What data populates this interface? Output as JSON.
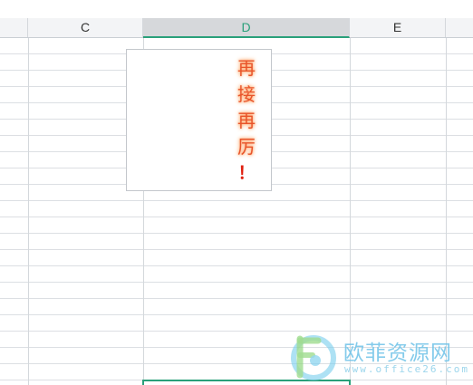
{
  "column_headers": {
    "left": "",
    "c": "C",
    "d": "D",
    "e": "E",
    "f": ""
  },
  "selected_column": "D",
  "text_box": {
    "chars": [
      "再",
      "接",
      "再",
      "厉",
      "！"
    ],
    "color": "#e8542a",
    "glow_color": "#ffb07a"
  },
  "watermark": {
    "title": "欧菲资源网",
    "url": "www.office26.com",
    "color": "#6fc3e8"
  },
  "colors": {
    "accent": "#2aa07a",
    "header_bg": "#f3f4f6",
    "selected_header_bg": "#d6d8db",
    "gridline": "#dcdfe3"
  }
}
